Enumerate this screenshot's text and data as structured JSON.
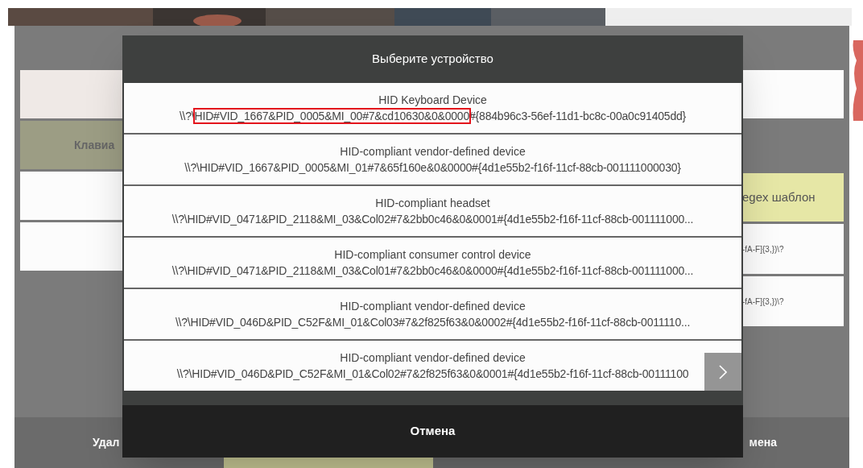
{
  "background": {
    "left_cells": [
      {
        "kind": "blank",
        "color": "#efe9e6"
      },
      {
        "kind": "label",
        "label": "Клавиа",
        "color": "#9c9d84"
      },
      {
        "kind": "blank",
        "color": "#fcfcfc"
      },
      {
        "kind": "blank",
        "color": "#fcfcfc"
      }
    ],
    "right_cells": [
      {
        "kind": "blank",
        "color": "#fcfcfc"
      },
      {
        "kind": "gap"
      },
      {
        "kind": "label",
        "label": "egex шаблон",
        "color": "#e6e7a6"
      },
      {
        "kind": "small",
        "label": "-fA-F]{3,})\\?",
        "color": "#fcfcfc"
      },
      {
        "kind": "small",
        "label": "-fA-F]{3,})\\?",
        "color": "#fcfcfc"
      }
    ],
    "bottom_left_button": "Удал",
    "bottom_right_button": "мена"
  },
  "dialog": {
    "title": "Выберите устройство",
    "devices": [
      {
        "name": "HID Keyboard Device",
        "path": [
          {
            "text": "\\\\?\\",
            "highlighted": false
          },
          {
            "text": "HID#VID_1667&PID_0005&MI_00#7&cd10630&0&0000",
            "highlighted": true
          },
          {
            "text": "#{884b96c3-56ef-11d1-bc8c-00a0c91405dd}",
            "highlighted": false
          }
        ]
      },
      {
        "name": "HID-compliant vendor-defined device",
        "path": [
          {
            "text": "\\\\?\\HID#VID_1667&PID_0005&MI_01#7&65f160e&0&0000#{4d1e55b2-f16f-11cf-88cb-001111000030}",
            "highlighted": false
          }
        ]
      },
      {
        "name": "HID-compliant headset",
        "path": [
          {
            "text": "\\\\?\\HID#VID_0471&PID_2118&MI_03&Col02#7&2bb0c46&0&0001#{4d1e55b2-f16f-11cf-88cb-001111000...",
            "highlighted": false
          }
        ]
      },
      {
        "name": "HID-compliant consumer control device",
        "path": [
          {
            "text": "\\\\?\\HID#VID_0471&PID_2118&MI_03&Col01#7&2bb0c46&0&0000#{4d1e55b2-f16f-11cf-88cb-001111000...",
            "highlighted": false
          }
        ]
      },
      {
        "name": "HID-compliant vendor-defined device",
        "path": [
          {
            "text": "\\\\?\\HID#VID_046D&PID_C52F&MI_01&Col03#7&2f825f63&0&0002#{4d1e55b2-f16f-11cf-88cb-0011110...",
            "highlighted": false
          }
        ]
      },
      {
        "name": "HID-compliant vendor-defined device",
        "path": [
          {
            "text": "\\\\?\\HID#VID_046D&PID_C52F&MI_01&Col02#7&2f825f63&0&0001#{4d1e55b2-f16f-11cf-88cb-00111100",
            "highlighted": false
          }
        ]
      }
    ],
    "cancel": "Отмена"
  }
}
